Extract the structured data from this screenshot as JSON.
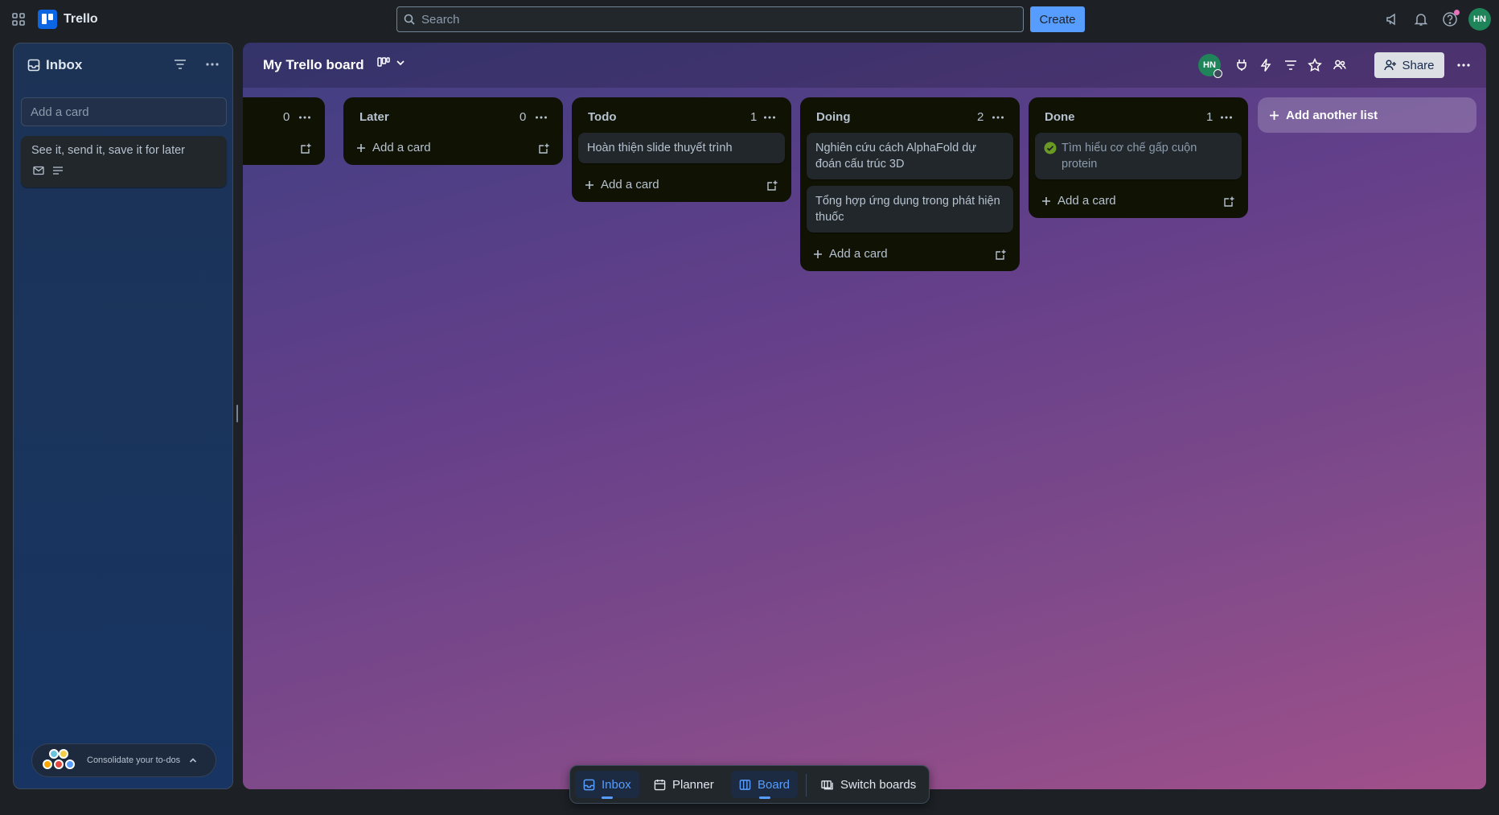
{
  "topbar": {
    "app_name": "Trello",
    "search_placeholder": "Search",
    "create_label": "Create",
    "user_initials": "HN"
  },
  "inbox": {
    "title": "Inbox",
    "add_card_placeholder": "Add a card",
    "cards": [
      {
        "text": "See it, send it, save it for later"
      }
    ],
    "consolidate_label": "Consolidate your to-dos"
  },
  "board": {
    "title": "My Trello board",
    "member_initials": "HN",
    "share_label": "Share",
    "add_list_label": "Add another list",
    "add_card_label": "Add a card",
    "lists": [
      {
        "name": "",
        "count": "0",
        "cards": []
      },
      {
        "name": "Later",
        "count": "0",
        "cards": []
      },
      {
        "name": "Todo",
        "count": "1",
        "cards": [
          "Hoàn thiện slide thuyết trình"
        ]
      },
      {
        "name": "Doing",
        "count": "2",
        "cards": [
          "Nghiên cứu cách AlphaFold dự đoán cấu trúc 3D",
          "Tổng hợp ứng dụng trong phát hiện thuốc"
        ]
      },
      {
        "name": "Done",
        "count": "1",
        "cards": [
          "Tìm hiểu cơ chế gấp cuộn protein"
        ]
      }
    ]
  },
  "bottom_nav": {
    "inbox": "Inbox",
    "planner": "Planner",
    "board": "Board",
    "switch_boards": "Switch boards"
  },
  "colors": {
    "accent": "#579dff",
    "brand": "#0c66e4",
    "avatar": "#1f845a",
    "list_bg": "#101204",
    "card_bg": "#22272b",
    "done_check": "#6a9a23"
  }
}
